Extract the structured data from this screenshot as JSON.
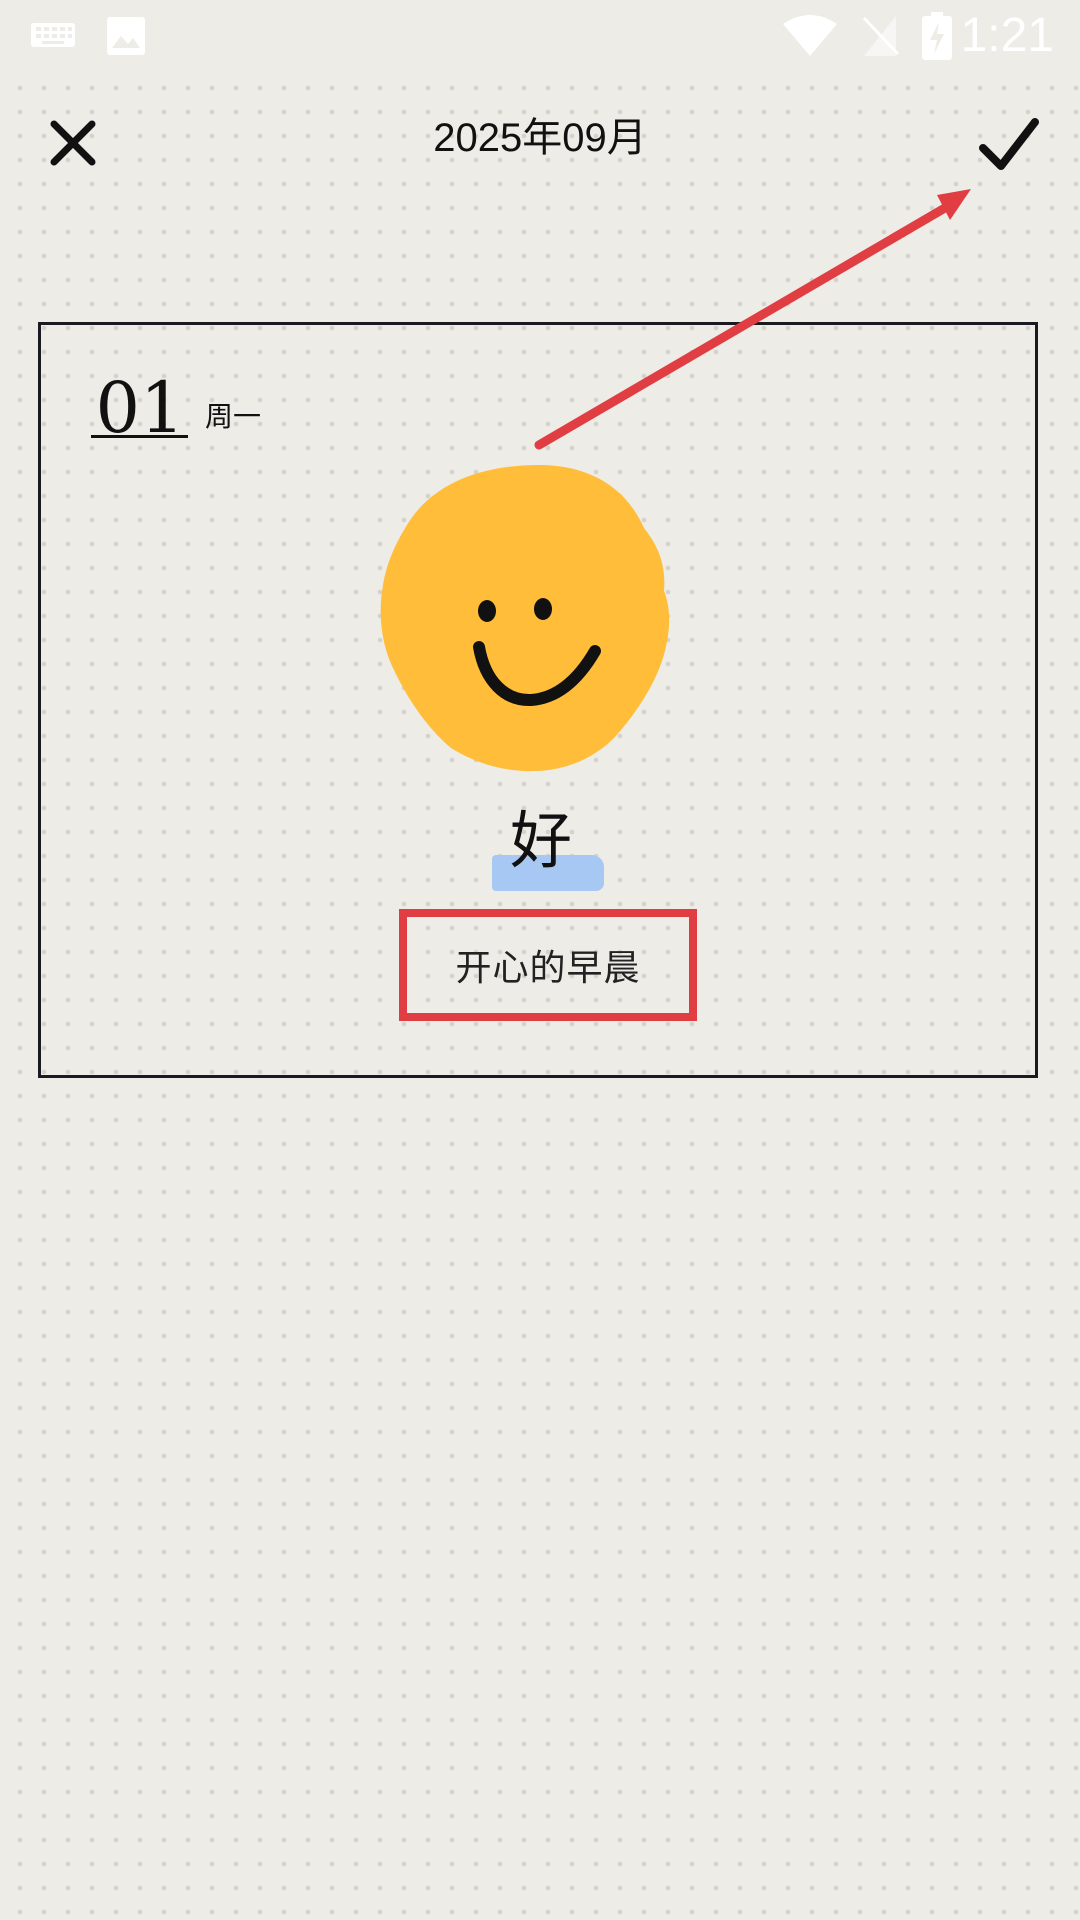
{
  "status_bar": {
    "time": "1:21",
    "icons": [
      "keyboard-icon",
      "image-icon",
      "wifi-icon",
      "no-sim-icon",
      "battery-charging-icon"
    ]
  },
  "header": {
    "month_title": "2025年09月",
    "close_icon": "close-icon",
    "confirm_icon": "checkmark-icon"
  },
  "entry": {
    "day": "01",
    "weekday": "周一",
    "mood_icon": "smiley-face-icon",
    "mood_label": "好",
    "note": "开心的早晨"
  },
  "colors": {
    "background": "#edece7",
    "mood_face": "#ffbd3a",
    "mood_highlight": "#a7c8f3",
    "annotation": "#e03e42",
    "card_border": "#1a1a22"
  }
}
